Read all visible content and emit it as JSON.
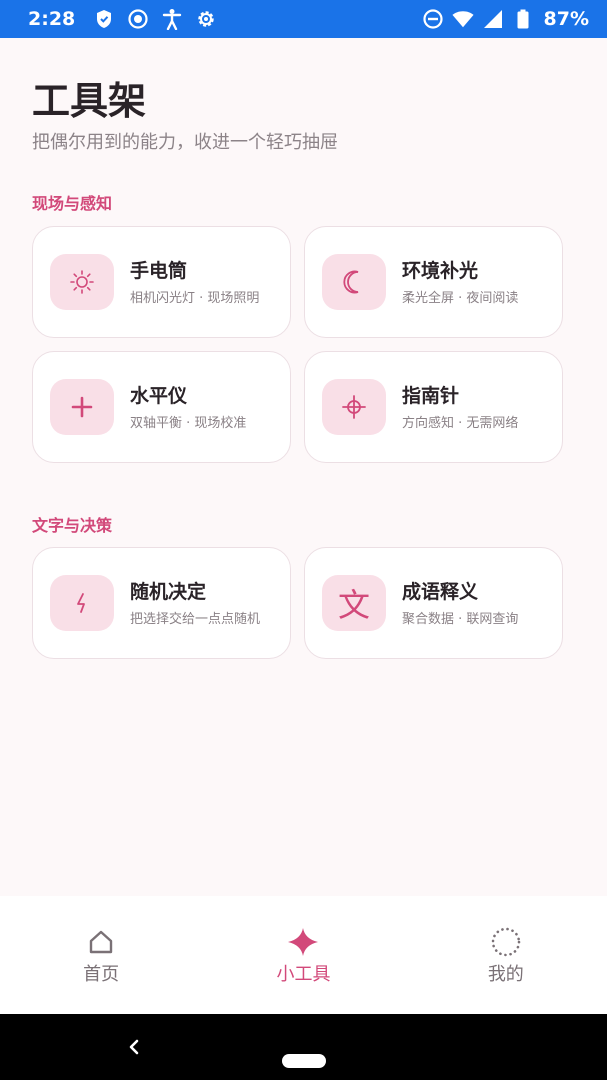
{
  "status_bar": {
    "time": "2:28",
    "battery": "87%",
    "icons": [
      "shield-icon",
      "record-icon",
      "accessibility-icon",
      "settings-gear-icon",
      "do-not-disturb-icon",
      "wifi-icon",
      "signal-icon",
      "battery-icon"
    ]
  },
  "header": {
    "title": "工具架",
    "subtitle": "把偶尔用到的能力，收进一个轻巧抽屉"
  },
  "sections": [
    {
      "title": "现场与感知",
      "cards": [
        {
          "title": "手电筒",
          "desc": "相机闪光灯 · 现场照明",
          "icon": "sun-icon"
        },
        {
          "title": "环境补光",
          "desc": "柔光全屏 · 夜间阅读",
          "icon": "moon-icon"
        },
        {
          "title": "水平仪",
          "desc": "双轴平衡 · 现场校准",
          "icon": "plus-icon"
        },
        {
          "title": "指南针",
          "desc": "方向感知 · 无需网络",
          "icon": "crosshair-icon"
        }
      ]
    },
    {
      "title": "文字与决策",
      "cards": [
        {
          "title": "随机决定",
          "desc": "把选择交给一点点随机",
          "icon": "lightning-icon"
        },
        {
          "title": "成语释义",
          "desc": "聚合数据 · 联网查询",
          "icon": "wen-character-icon",
          "icon_glyph": "文"
        }
      ]
    }
  ],
  "bottom_nav": {
    "items": [
      {
        "label": "首页",
        "icon": "home-icon",
        "active": false
      },
      {
        "label": "小工具",
        "icon": "sparkle-icon",
        "active": true
      },
      {
        "label": "我的",
        "icon": "profile-dots-icon",
        "active": false
      }
    ]
  },
  "colors": {
    "status_bar": "#1a73e8",
    "accent": "#d2497a",
    "icon_tile": "#f9dfe7",
    "background": "#fdf8f9"
  }
}
